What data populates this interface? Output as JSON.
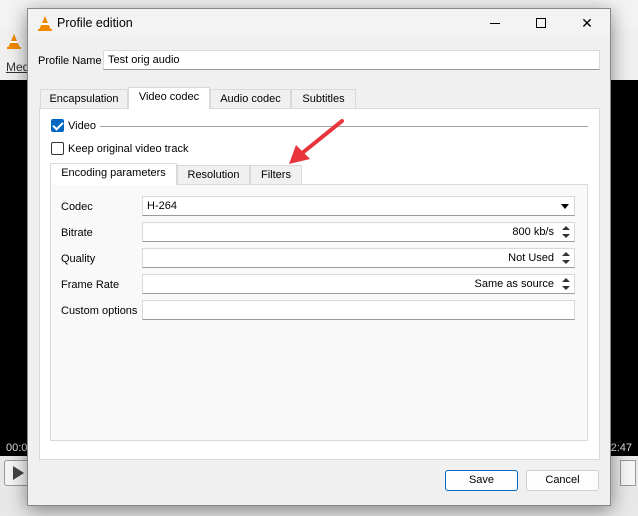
{
  "window": {
    "title": "Profile edition",
    "minimize_icon": "minimize-icon",
    "maximize_icon": "maximize-icon",
    "close_glyph": "✕"
  },
  "background": {
    "menu_hint": "Med",
    "time_left": "00:0",
    "time_right": "2:47"
  },
  "profile": {
    "name_label": "Profile Name",
    "name_value": "Test orig audio"
  },
  "main_tabs": [
    "Encapsulation",
    "Video codec",
    "Audio codec",
    "Subtitles"
  ],
  "video": {
    "video_checkbox_label": "Video",
    "video_checked": true,
    "keep_original_label": "Keep original video track",
    "keep_original_checked": false
  },
  "sub_tabs": [
    "Encoding parameters",
    "Resolution",
    "Filters"
  ],
  "encoding": {
    "codec_label": "Codec",
    "codec_value": "H-264",
    "bitrate_label": "Bitrate",
    "bitrate_value": "800 kb/s",
    "quality_label": "Quality",
    "quality_value": "Not Used",
    "framerate_label": "Frame Rate",
    "framerate_value": "Same as source",
    "custom_label": "Custom options",
    "custom_value": ""
  },
  "buttons": {
    "save": "Save",
    "cancel": "Cancel"
  },
  "colors": {
    "accent": "#0067c0",
    "annotation_arrow": "#e8343a"
  }
}
